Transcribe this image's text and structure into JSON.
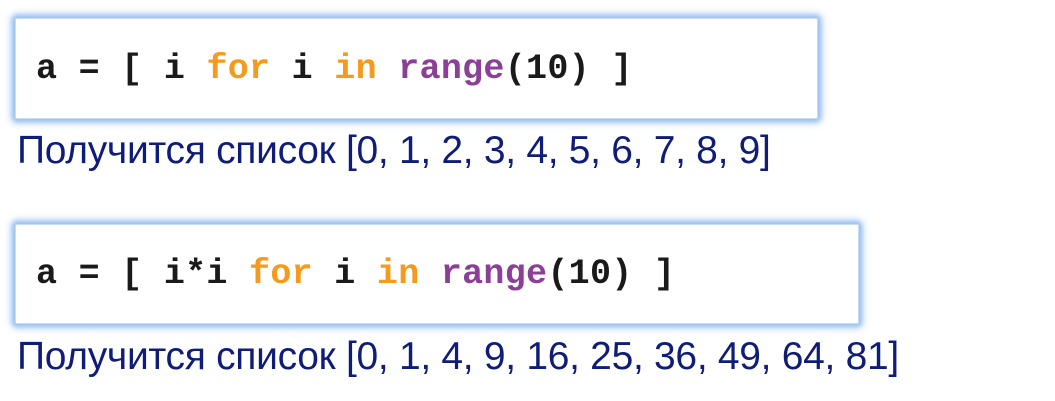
{
  "examples": [
    {
      "code": {
        "prefix": "a = [ ",
        "expr": "i",
        "kw_for": "for",
        "loop_var": " i ",
        "kw_in": "in",
        "fn_range": "range",
        "args": "(10)",
        "suffix": " ]"
      },
      "result_label": "Получится список",
      "result_value": "[0, 1, 2, 3, 4, 5, 6, 7, 8, 9]"
    },
    {
      "code": {
        "prefix": "a = [ ",
        "expr": "i*i",
        "kw_for": "for",
        "loop_var": " i ",
        "kw_in": "in",
        "fn_range": "range",
        "args": "(10)",
        "suffix": " ]"
      },
      "result_label": "Получится список",
      "result_value": "[0, 1, 4, 9, 16, 25, 36, 49, 64, 81]"
    }
  ],
  "colors": {
    "keyword": "#f59a1b",
    "function": "#8c3f96",
    "code_text": "#1a1a1a",
    "result_text": "#0f1d78",
    "box_glow": "#9cc2f0"
  }
}
